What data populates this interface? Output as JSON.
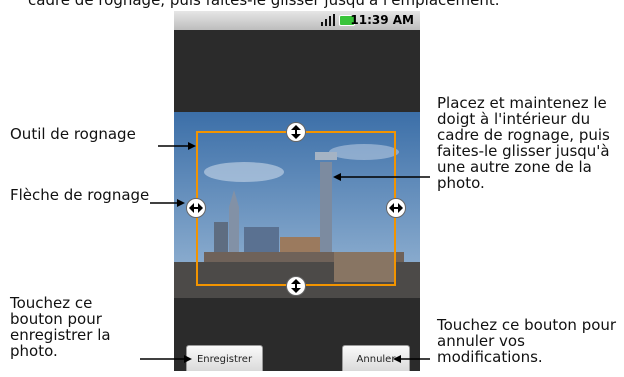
{
  "top_caption": "cadre de rognage, puis faites-le glisser jusqu'à l'emplacement.",
  "annotations": {
    "crop_tool": "Outil de rognage",
    "crop_arrow": "Flèche de rognage",
    "drag_inside": "Placez et maintenez le doigt à l'intérieur du cadre de rognage, puis faites-le glisser jusqu'à une autre zone de la photo.",
    "save_hint": "Touchez ce bouton pour enregistrer la photo.",
    "cancel_hint": "Touchez ce bouton pour annuler vos modifications."
  },
  "status_bar": {
    "time": "11:39 AM",
    "battery_color": "#39c43a",
    "signal_icon": "signal-icon"
  },
  "buttons": {
    "save": "Enregistrer",
    "cancel": "Annuler"
  },
  "colors": {
    "crop_frame": "#f29400",
    "screen_bg": "#2b2b2b"
  }
}
